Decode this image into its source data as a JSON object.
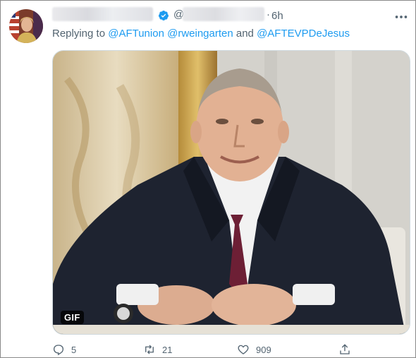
{
  "tweet": {
    "handle_prefix": "@",
    "separator": "·",
    "time": "6h",
    "reply_prefix": "Replying to",
    "reply_mentions": [
      "@AFTunion",
      "@rweingarten"
    ],
    "reply_conjunction": "and",
    "reply_last_mention": "@AFTEVPDeJesus",
    "media_badge": "GIF"
  },
  "actions": {
    "reply_count": "5",
    "retweet_count": "21",
    "like_count": "909"
  },
  "colors": {
    "link": "#1d9bf0",
    "secondary_text": "#536471",
    "verified": "#1d9bf0"
  },
  "icons": [
    "verified-badge-icon",
    "more-icon",
    "reply-icon",
    "retweet-icon",
    "like-icon",
    "share-icon"
  ]
}
